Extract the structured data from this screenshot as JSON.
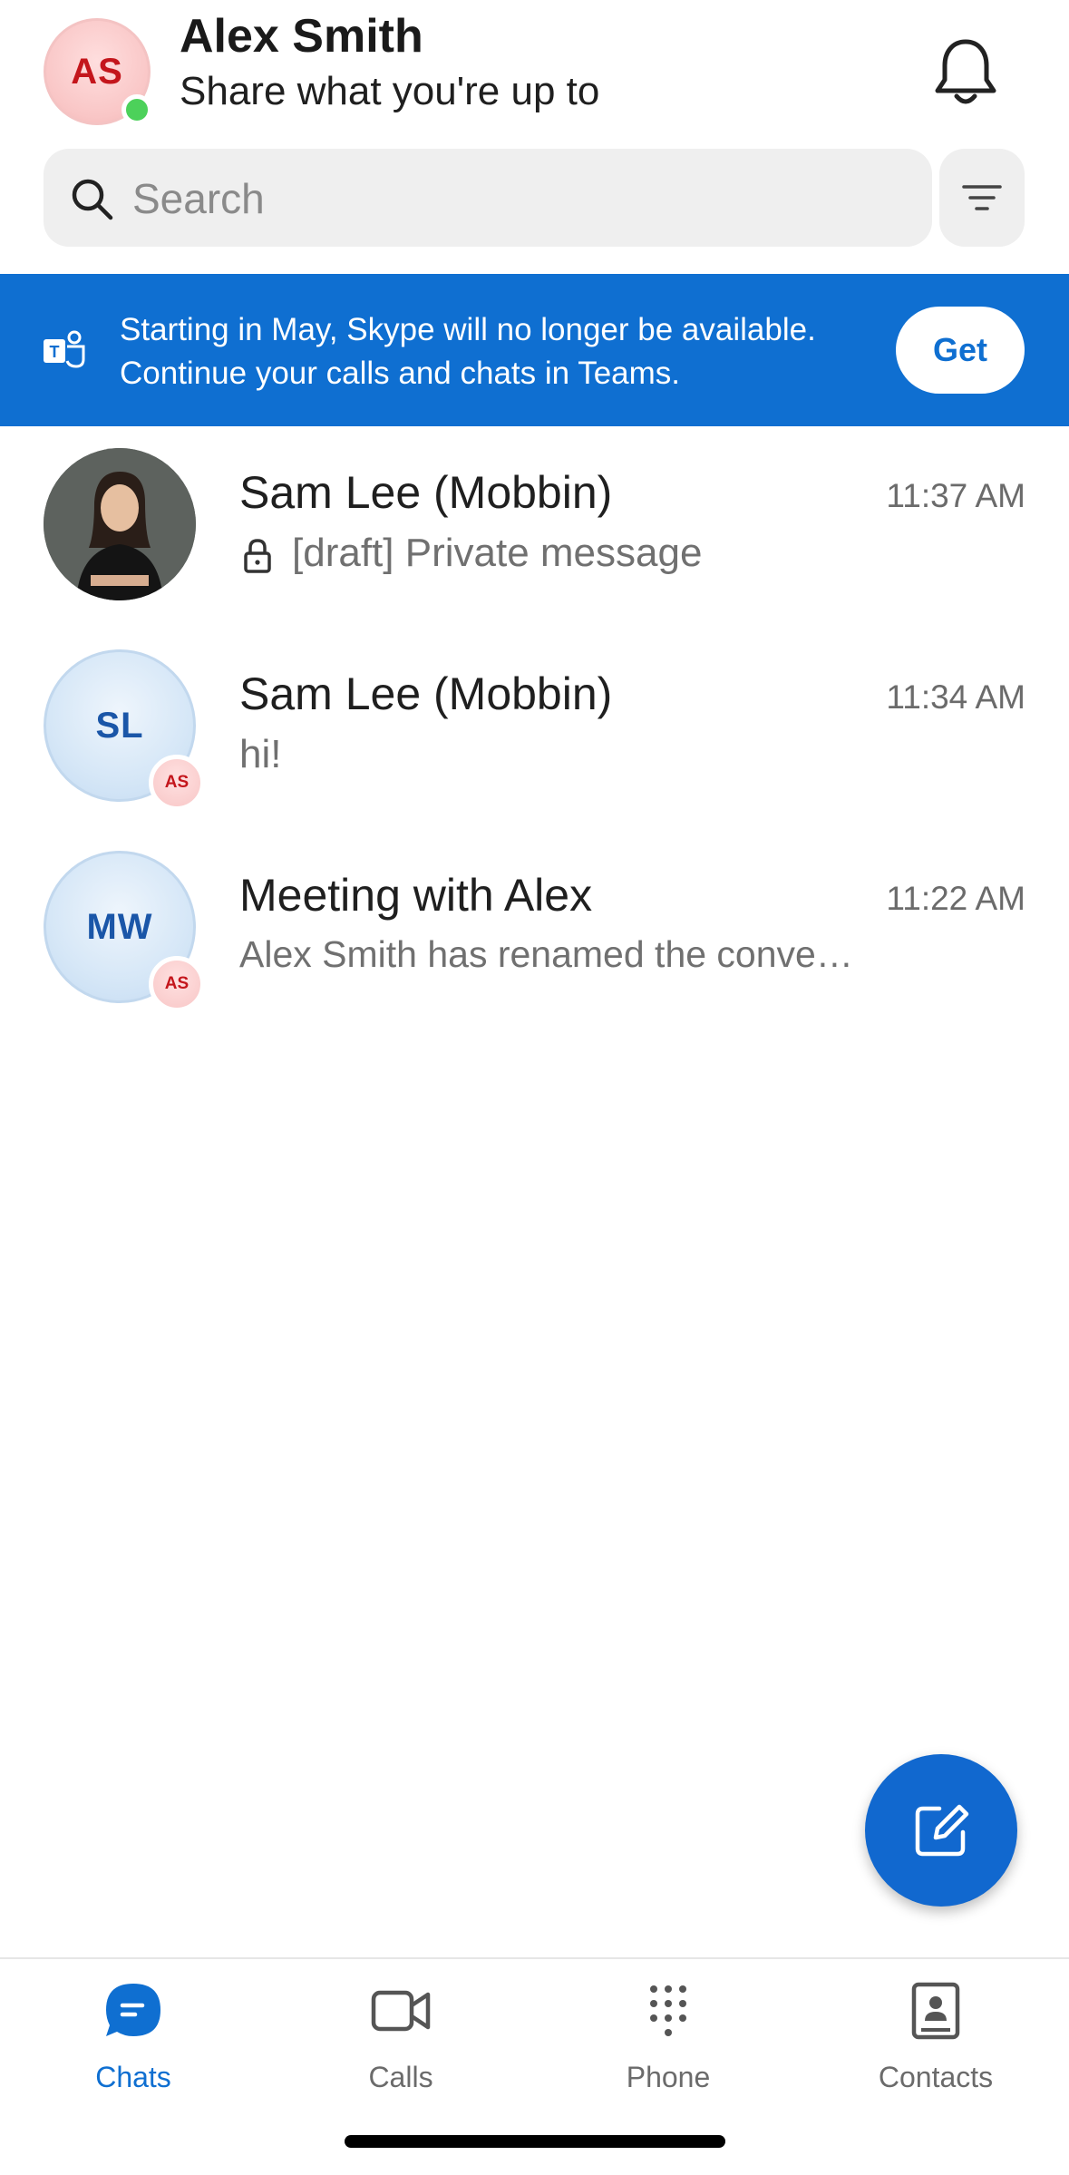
{
  "header": {
    "avatar_initials": "AS",
    "name": "Alex Smith",
    "status": "Share what you're up to",
    "notification_icon": "bell-icon"
  },
  "search": {
    "placeholder": "Search",
    "value": ""
  },
  "banner": {
    "line1": "Starting in May, Skype will no longer be available.",
    "line2": "Continue your calls and chats in Teams.",
    "button": "Get"
  },
  "chats": [
    {
      "name": "Sam Lee (Mobbin)",
      "time": "11:37 AM",
      "message": "[draft] Private message",
      "avatar": "photo",
      "locked": true
    },
    {
      "name": "Sam Lee (Mobbin)",
      "time": "11:34 AM",
      "message": "hi!",
      "initials": "SL",
      "badge": "AS"
    },
    {
      "name": "Meeting with Alex",
      "time": "11:22 AM",
      "message": "Alex Smith has renamed the conve…",
      "initials": "MW",
      "badge": "AS"
    }
  ],
  "nav": {
    "items": [
      {
        "label": "Chats",
        "icon": "chat-bubble-icon",
        "active": true
      },
      {
        "label": "Calls",
        "icon": "video-camera-icon"
      },
      {
        "label": "Phone",
        "icon": "dialpad-icon"
      },
      {
        "label": "Contacts",
        "icon": "contact-book-icon"
      }
    ]
  },
  "colors": {
    "accent": "#0f6fd1",
    "presence": "#4cd15a",
    "badge_text": "#c4161c"
  }
}
